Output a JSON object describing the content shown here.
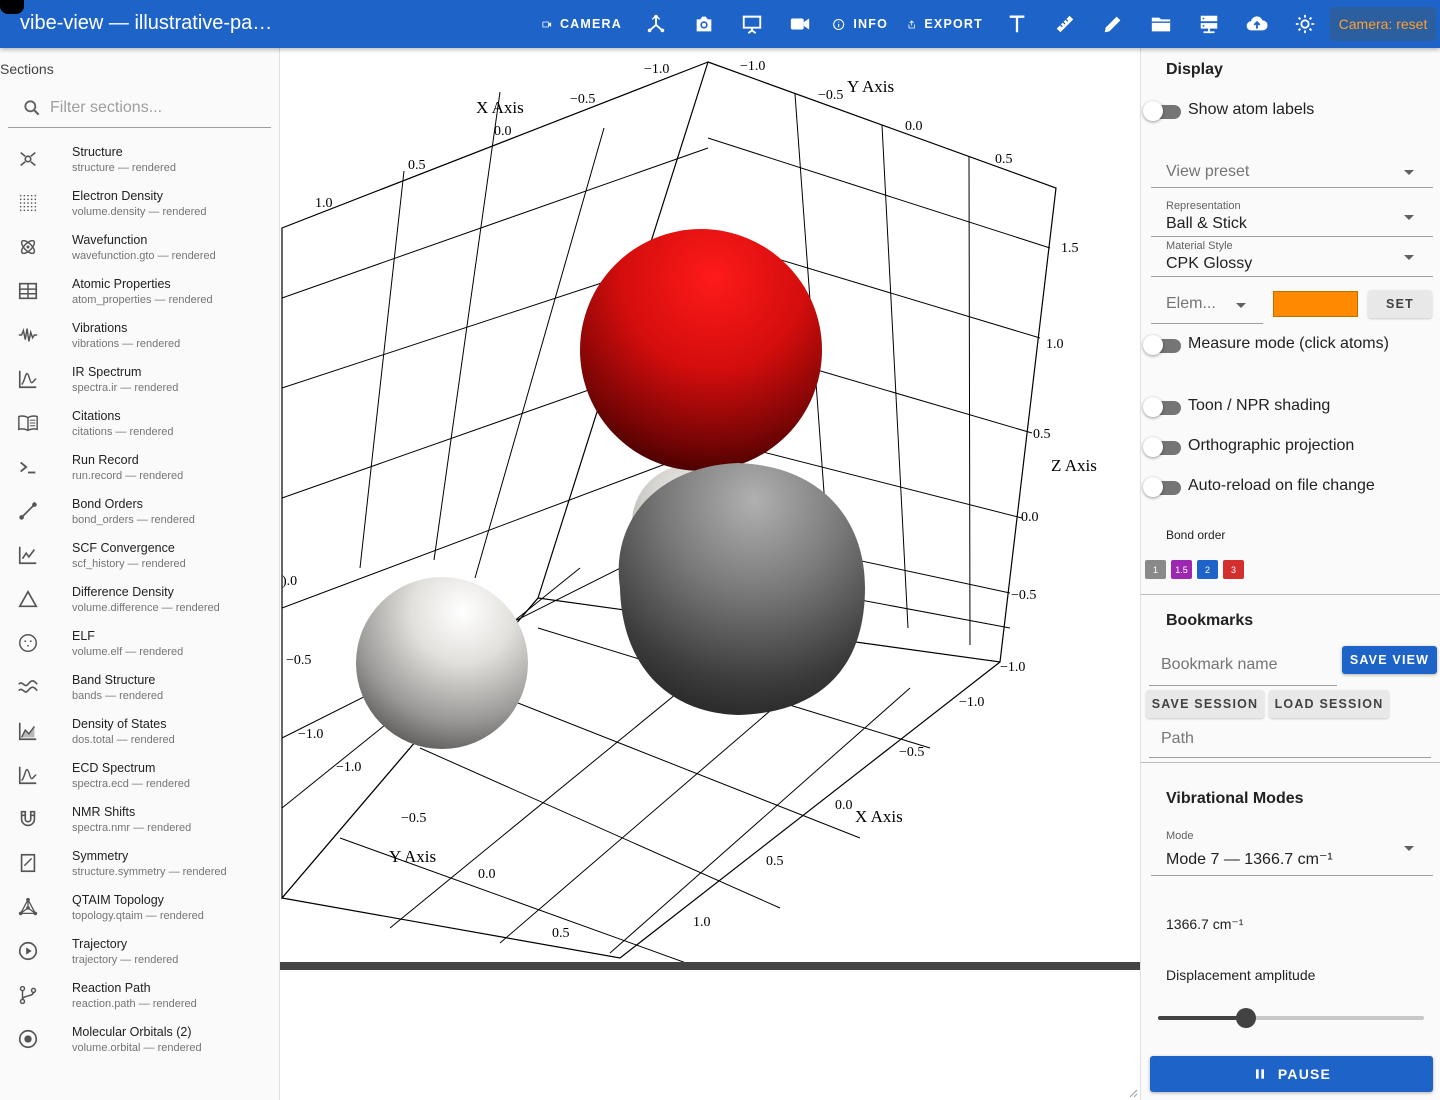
{
  "app": {
    "title": "vibe-view — illustrative-pan..."
  },
  "toolbar": {
    "camera_label": "CAMERA",
    "info_label": "INFO",
    "export_label": "EXPORT",
    "camera_status": "Camera: reset",
    "icons": [
      "camera-settings-icon",
      "axes-icon",
      "screenshot-icon",
      "presentation-icon",
      "video-icon",
      "info-icon",
      "export-icon",
      "text-icon",
      "ruler-icon",
      "pencil-icon",
      "folder-icon",
      "server-icon",
      "cloud-upload-icon",
      "theme-icon"
    ]
  },
  "sidebar": {
    "heading": "Sections",
    "filter_placeholder": "Filter sections...",
    "items": [
      {
        "title": "Structure",
        "subtitle": "structure — rendered",
        "icon": "molecule-icon"
      },
      {
        "title": "Electron Density",
        "subtitle": "volume.density — rendered",
        "icon": "dot-grid-icon"
      },
      {
        "title": "Wavefunction",
        "subtitle": "wavefunction.gto — rendered",
        "icon": "atom-icon"
      },
      {
        "title": "Atomic Properties",
        "subtitle": "atom_properties — rendered",
        "icon": "table-icon"
      },
      {
        "title": "Vibrations",
        "subtitle": "vibrations — rendered",
        "icon": "waveform-icon"
      },
      {
        "title": "IR Spectrum",
        "subtitle": "spectra.ir — rendered",
        "icon": "spectrum-icon"
      },
      {
        "title": "Citations",
        "subtitle": "citations — rendered",
        "icon": "book-icon"
      },
      {
        "title": "Run Record",
        "subtitle": "run.record — rendered",
        "icon": "console-icon"
      },
      {
        "title": "Bond Orders",
        "subtitle": "bond_orders — rendered",
        "icon": "bond-icon"
      },
      {
        "title": "SCF Convergence",
        "subtitle": "scf_history — rendered",
        "icon": "line-chart-icon"
      },
      {
        "title": "Difference Density",
        "subtitle": "volume.difference — rendered",
        "icon": "triangle-icon"
      },
      {
        "title": "ELF",
        "subtitle": "volume.elf — rendered",
        "icon": "dotted-circle-icon"
      },
      {
        "title": "Band Structure",
        "subtitle": "bands — rendered",
        "icon": "bands-icon"
      },
      {
        "title": "Density of States",
        "subtitle": "dos.total — rendered",
        "icon": "area-chart-icon"
      },
      {
        "title": "ECD Spectrum",
        "subtitle": "spectra.ecd — rendered",
        "icon": "spectrum-icon"
      },
      {
        "title": "NMR Shifts",
        "subtitle": "spectra.nmr — rendered",
        "icon": "magnet-icon"
      },
      {
        "title": "Symmetry",
        "subtitle": "structure.symmetry — rendered",
        "icon": "symmetry-icon"
      },
      {
        "title": "QTAIM Topology",
        "subtitle": "topology.qtaim — rendered",
        "icon": "graph-icon"
      },
      {
        "title": "Trajectory",
        "subtitle": "trajectory — rendered",
        "icon": "play-circle-icon"
      },
      {
        "title": "Reaction Path",
        "subtitle": "reaction.path — rendered",
        "icon": "branch-icon"
      },
      {
        "title": "Molecular Orbitals (2)",
        "subtitle": "volume.orbital — rendered",
        "icon": "orbital-icon"
      }
    ]
  },
  "viewer": {
    "axis_titles": {
      "x_top": "X Axis",
      "y_top": "Y Axis",
      "z": "Z Axis",
      "x_bottom": "X Axis",
      "y_bottom": "Y Axis"
    },
    "ticks": {
      "x_top": [
        "−0.5",
        "0.0",
        "0.5",
        "1.0"
      ],
      "y_top": [
        "−1.0",
        "−0.5",
        "0.0",
        "0.5"
      ],
      "top_center": "−1.0",
      "z": [
        "1.5",
        "1.0",
        "0.5",
        "0.0",
        "−0.5",
        "−1.0"
      ],
      "x_bottom": [
        "−1.0",
        "−0.5",
        "0.0",
        "0.5",
        "1.0"
      ],
      "y_bottom": [
        "−1.0",
        "−0.5",
        "0.0",
        "0.5"
      ],
      "left_edge": [
        ").0",
        "−0.5",
        "−1.0"
      ]
    }
  },
  "display": {
    "heading": "Display",
    "show_atom_labels": "Show atom labels",
    "view_preset_placeholder": "View preset",
    "representation_label": "Representation",
    "representation_value": "Ball & Stick",
    "material_label": "Material Style",
    "material_value": "CPK Glossy",
    "element_placeholder": "Elem...",
    "element_color": "#ff8a00",
    "set_label": "SET",
    "measure_mode": "Measure mode (click atoms)",
    "toon_shading": "Toon / NPR shading",
    "orthographic": "Orthographic projection",
    "auto_reload": "Auto-reload on file change",
    "bond_order_label": "Bond order",
    "bond_orders": [
      {
        "label": "1",
        "color": "#8a8a8a"
      },
      {
        "label": "1.5",
        "color": "#9c27b0"
      },
      {
        "label": "2",
        "color": "#1e64c8"
      },
      {
        "label": "3",
        "color": "#d32f2f"
      }
    ]
  },
  "bookmarks": {
    "heading": "Bookmarks",
    "name_placeholder": "Bookmark name",
    "save_view": "SAVE VIEW",
    "save_session": "SAVE SESSION",
    "load_session": "LOAD SESSION",
    "path_placeholder": "Path"
  },
  "vibrational_modes": {
    "heading": "Vibrational Modes",
    "mode_label": "Mode",
    "mode_value": "Mode 7 — 1366.7 cm⁻¹",
    "frequency": "1366.7 cm⁻¹",
    "amplitude_label": "Displacement amplitude",
    "amplitude_fraction": 0.33,
    "pause_label": "PAUSE"
  }
}
